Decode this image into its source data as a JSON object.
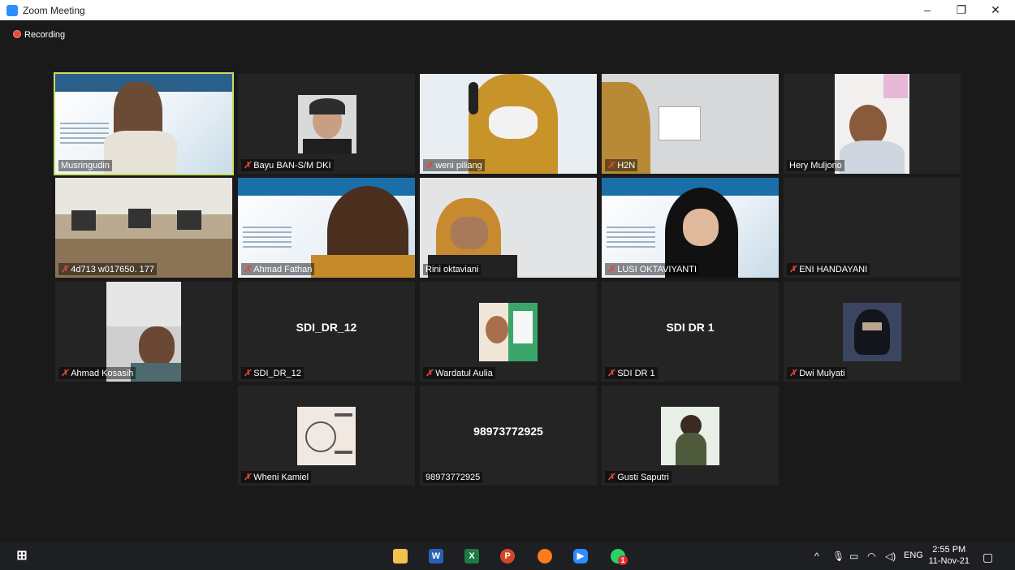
{
  "window": {
    "title": "Zoom Meeting",
    "minimize": "–",
    "restore": "❐",
    "close": "✕"
  },
  "recording": {
    "label": "Recording"
  },
  "participants": [
    {
      "name": "Musringudin",
      "muted": false,
      "active": true
    },
    {
      "name": "Bayu BAN-S/M DKI",
      "muted": true
    },
    {
      "name": "weni piliang",
      "muted": true
    },
    {
      "name": "H2N",
      "muted": true
    },
    {
      "name": "Hery Muljono",
      "muted": false
    },
    {
      "name": "4d713 w017650. 177",
      "muted": true
    },
    {
      "name": "Ahmad Fathan",
      "muted": true
    },
    {
      "name": "Rini oktaviani",
      "muted": false
    },
    {
      "name": "LUSI OKTAVIYANTI",
      "muted": true
    },
    {
      "name": "ENI HANDAYANI",
      "muted": true
    },
    {
      "name": "Ahmad Kosasih",
      "muted": true
    },
    {
      "name": "SDI_DR_12",
      "muted": true,
      "display": "SDI_DR_12"
    },
    {
      "name": "Wardatul Aulia",
      "muted": true
    },
    {
      "name": "SDI DR 1",
      "muted": true,
      "display": "SDI DR 1"
    },
    {
      "name": "Dwi Mulyati",
      "muted": true
    },
    {
      "name": "Wheni Kamiel",
      "muted": true
    },
    {
      "name": "98973772925",
      "muted": false,
      "display": "98973772925"
    },
    {
      "name": "Gusti Saputri",
      "muted": true
    }
  ],
  "mute_glyph": "🎤̸",
  "taskbar": {
    "start_icon": "windows-start-icon",
    "apps": [
      "file-explorer-icon",
      "word-icon",
      "excel-icon",
      "powerpoint-icon",
      "firefox-icon",
      "zoom-icon",
      "whatsapp-icon"
    ],
    "whatsapp_badge": "1",
    "tray_lang": "ENG",
    "time": "2:55 PM",
    "date": "11-Nov-21"
  },
  "colors": {
    "active_border": "#c7de5c",
    "mute": "#e0473a",
    "recording": "#e8493a"
  }
}
